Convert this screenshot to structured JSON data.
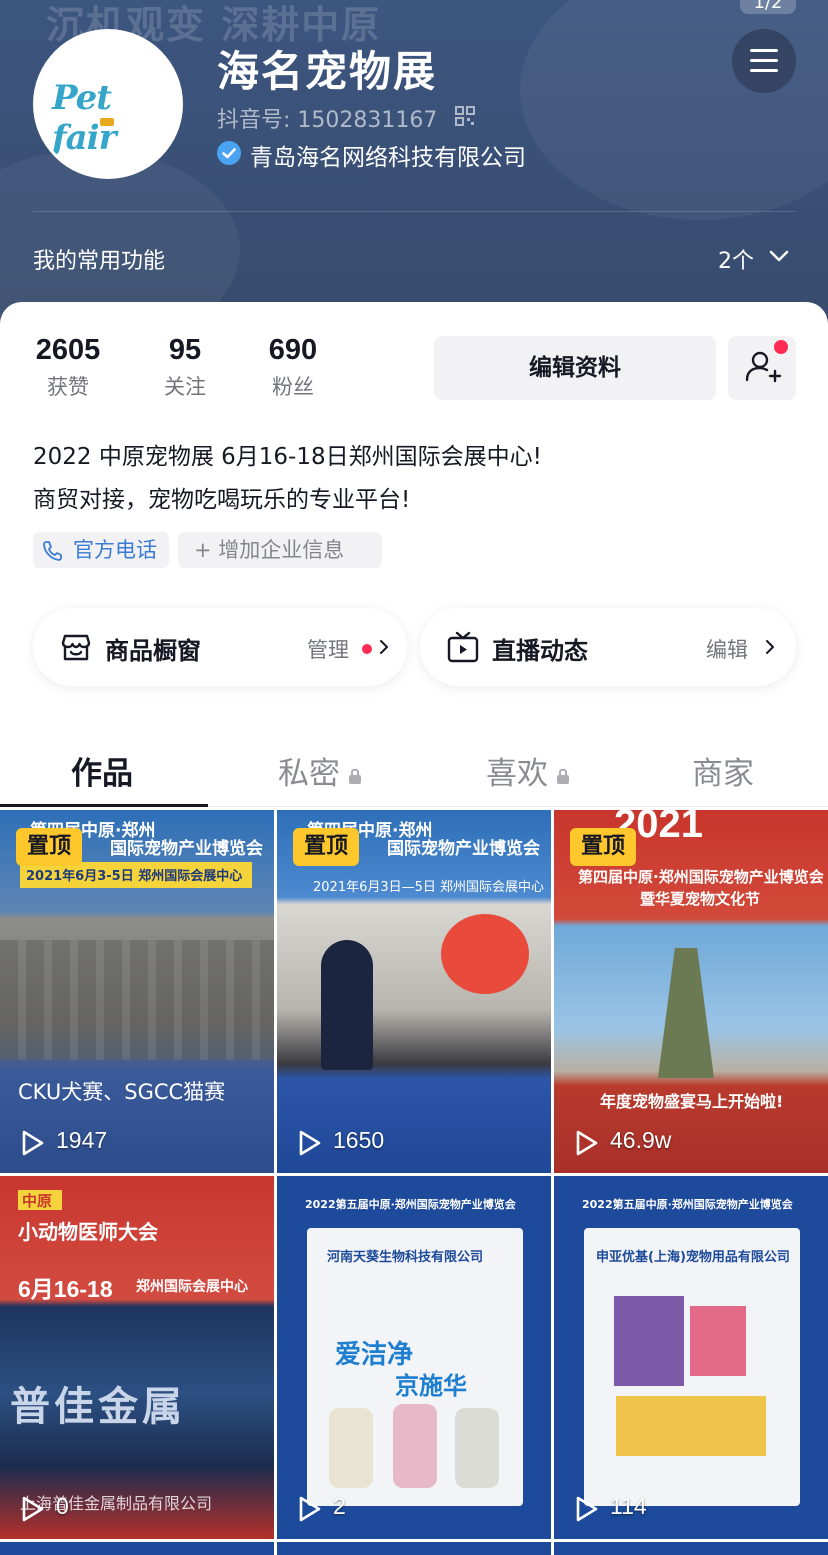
{
  "header": {
    "bg_slogan": "沉机观变 深耕中原",
    "page_indicator": "1/2",
    "nickname": "海名宠物展",
    "douyin_id": "抖音号: 1502831167",
    "verified_org": "青岛海名网络科技有限公司",
    "avatar_logo": "Pet fair",
    "common_functions_label": "我的常用功能",
    "common_functions_count": "2个"
  },
  "stats": [
    {
      "value": "2605",
      "label": "获赞"
    },
    {
      "value": "95",
      "label": "关注"
    },
    {
      "value": "690",
      "label": "粉丝"
    }
  ],
  "actions": {
    "edit_profile": "编辑资料"
  },
  "bio": {
    "line1": "2022 中原宠物展 6月16-18日郑州国际会展中心!",
    "line2": "商贸对接，宠物吃喝玩乐的专业平台!"
  },
  "tags": {
    "phone": "官方电话",
    "add_company": "+ 增加企业信息"
  },
  "features": {
    "shop_title": "商品橱窗",
    "shop_action": "管理",
    "live_title": "直播动态",
    "live_action": "编辑"
  },
  "tabs": [
    {
      "label": "作品"
    },
    {
      "label": "私密"
    },
    {
      "label": "喜欢"
    },
    {
      "label": "商家"
    }
  ],
  "videos": [
    {
      "pinned": "置顶",
      "plays": "1947",
      "line1": "第四届中原·郑州",
      "line2": "国际宠物产业博览会",
      "line3": "2021年6月3-5日  郑州国际会展中心",
      "caption": "CKU犬赛、SGCC猫赛"
    },
    {
      "pinned": "置顶",
      "plays": "1650",
      "line1": "第四届中原·郑州",
      "line2": "国际宠物产业博览会",
      "line3": "2021年6月3日—5日  郑州国际会展中心"
    },
    {
      "pinned": "置顶",
      "plays": "46.9w",
      "line1": "2021",
      "line2": "第四届中原·郑州国际宠物产业博览会",
      "line3": "暨华夏宠物文化节",
      "caption": "年度宠物盛宴马上开始啦!"
    },
    {
      "plays": "0",
      "line1": "中原",
      "line2": "小动物医师大会",
      "line3": "6月16-18",
      "line4": "郑州国际会展中心",
      "caption": "上海普佳金属制品有限公司",
      "big": "普佳金属"
    },
    {
      "plays": "2",
      "line1": "2022第五届中原·郑州国际宠物产业博览会",
      "line2": "河南天葵生物科技有限公司",
      "product": "爱洁净",
      "product2": "京施华"
    },
    {
      "plays": "114",
      "line1": "2022第五届中原·郑州国际宠物产业博览会",
      "line2": "申亚优基(上海)宠物用品有限公司"
    }
  ]
}
